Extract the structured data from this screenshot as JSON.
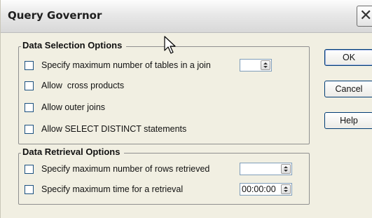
{
  "window": {
    "title": "Query Governor",
    "close_glyph": "✕"
  },
  "selection_group": {
    "legend": "Data Selection Options",
    "options": [
      {
        "label": "Specify maximum number of tables in a join",
        "checked": false
      },
      {
        "label": "Allow  cross products",
        "checked": false
      },
      {
        "label": "Allow outer joins",
        "checked": false
      },
      {
        "label": "Allow SELECT DISTINCT statements",
        "checked": false
      }
    ],
    "max_tables_value": ""
  },
  "retrieval_group": {
    "legend": "Data Retrieval Options",
    "options": [
      {
        "label": "Specify maximum number of rows retrieved",
        "checked": false
      },
      {
        "label": "Specify maximum time for a retrieval",
        "checked": false
      }
    ],
    "max_rows_value": "",
    "max_time_value": "00:00:00"
  },
  "buttons": {
    "ok": "OK",
    "cancel": "Cancel",
    "help": "Help"
  },
  "cursor": "arrow-pointer-icon"
}
